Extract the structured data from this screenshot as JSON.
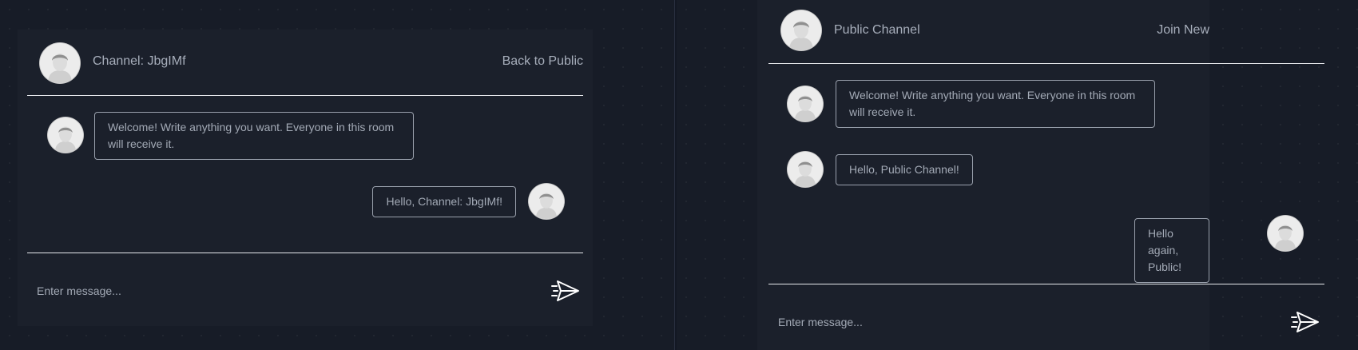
{
  "left_chat": {
    "title": "Channel: JbgIMf",
    "action": "Back to Public",
    "messages": [
      {
        "text": "Welcome! Write anything you want. Everyone in this room will receive it.",
        "side": "incoming"
      },
      {
        "text": "Hello, Channel: JbgIMf!",
        "side": "outgoing"
      }
    ],
    "input_placeholder": "Enter message..."
  },
  "right_chat": {
    "title": "Public Channel",
    "action": "Join New",
    "messages": [
      {
        "text": "Welcome! Write anything you want. Everyone in this room will receive it.",
        "side": "incoming"
      },
      {
        "text": "Hello, Public Channel!",
        "side": "incoming"
      },
      {
        "text": "Hello again, Public!",
        "side": "outgoing"
      }
    ],
    "input_placeholder": "Enter message..."
  },
  "icons": {
    "avatar": "user-avatar-icon",
    "send": "paper-plane-icon"
  },
  "colors": {
    "background": "#171c27",
    "card": "#1b202b",
    "text": "#a7aebb",
    "border": "#9aa1ad",
    "rule": "#e6e8ec"
  }
}
